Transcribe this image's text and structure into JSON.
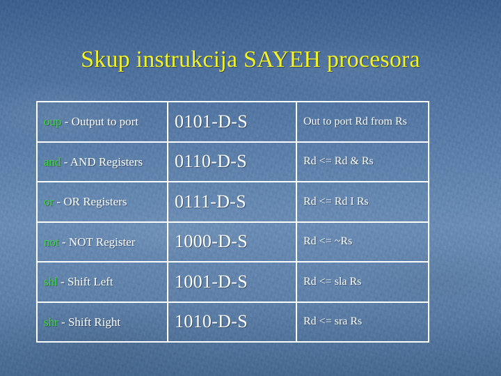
{
  "slide": {
    "title": "Skup instrukcija SAYEH procesora",
    "background_top_color": "#3d5f8d",
    "background_mid_color": "#6a8cb4",
    "background_bottom_color": "#47688f",
    "title_color": "#f2f224",
    "border_color": "#ffffff",
    "text_color": "#ffffff",
    "keyword_color": "#3bd43b"
  },
  "table": {
    "rows": [
      {
        "keyword": "oup",
        "description": " - Output to port",
        "encoding": "0101-D-S",
        "operation": "Out to port Rd from Rs"
      },
      {
        "keyword": "and",
        "description": " - AND Registers",
        "encoding": "0110-D-S",
        "operation": "Rd <= Rd & Rs"
      },
      {
        "keyword": "or",
        "description": " - OR Registers",
        "encoding": "0111-D-S",
        "operation": "Rd <= Rd I Rs"
      },
      {
        "keyword": "not",
        "description": " - NOT Register",
        "encoding": "1000-D-S",
        "operation": "Rd <= ~Rs"
      },
      {
        "keyword": "shl",
        "description": " - Shift Left",
        "encoding": "1001-D-S",
        "operation": "Rd <= sla Rs"
      },
      {
        "keyword": "shr",
        "description": " - Shift Right",
        "encoding": "1010-D-S",
        "operation": "Rd <= sra Rs"
      }
    ]
  }
}
